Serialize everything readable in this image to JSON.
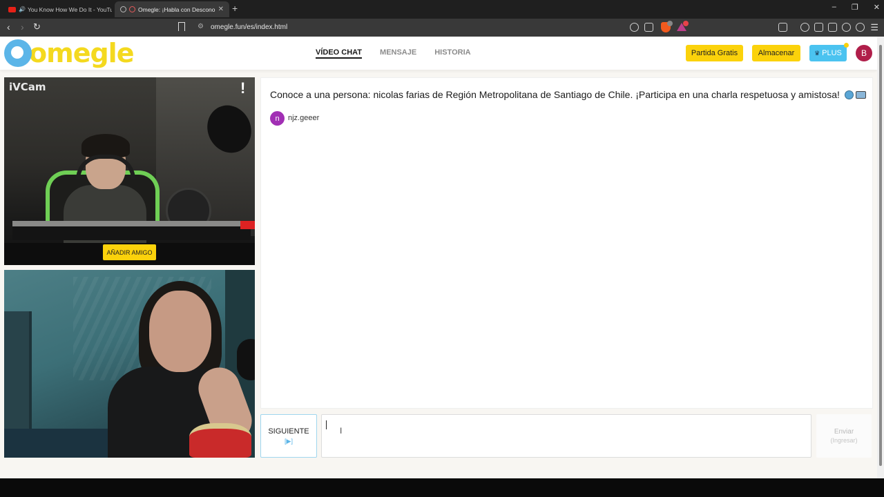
{
  "browser": {
    "tabs": [
      {
        "title": "You Know How We Do It - YouTu"
      },
      {
        "title": "Omegle: ¡Habla con Descono"
      }
    ],
    "new_tab": "+",
    "url": "omegle.fun/es/index.html",
    "window_controls": {
      "minimize": "–",
      "restore": "❐",
      "close": "✕"
    }
  },
  "site": {
    "logo_text": "omegle",
    "nav": [
      {
        "label": "VÍDEO CHAT",
        "active": true
      },
      {
        "label": "MENSAJE",
        "active": false
      },
      {
        "label": "HISTORIA",
        "active": false
      }
    ],
    "buttons": {
      "partida": "Partida Gratis",
      "almacenar": "Almacenar",
      "plus": "PLUS"
    },
    "avatar_letter": "B"
  },
  "video": {
    "camera_label": "iVCam",
    "report_symbol": "!",
    "add_friend": "AÑADIR AMIGO"
  },
  "chat": {
    "intro": "Conoce a una persona: nicolas farias de Región Metropolitana de Santiago de Chile. ¡Participa en una charla respetuosa y amistosa!",
    "user": {
      "initial": "n",
      "name": "njz.geeer"
    },
    "next_label": "SIGUIENTE",
    "next_key": "[▶]",
    "send_label": "Enviar",
    "send_key": "(Ingresar)",
    "input_value": ""
  },
  "colors": {
    "brand_yellow": "#fbd20b",
    "brand_blue": "#5bb5e8",
    "plus_blue": "#4bc3f0",
    "avatar_red": "#b01e4a",
    "user_purple": "#a12fb4"
  }
}
